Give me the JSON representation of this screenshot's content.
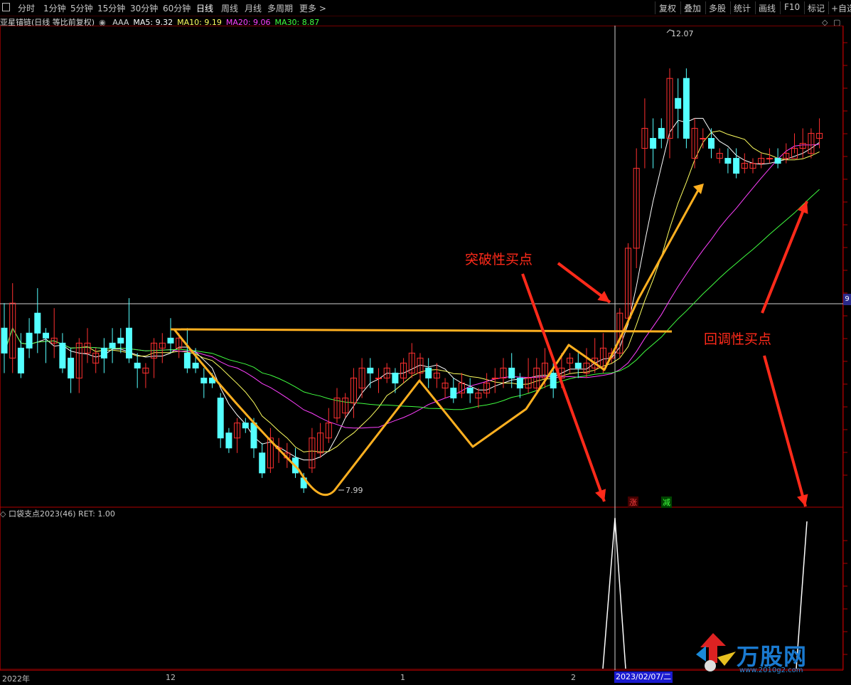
{
  "toolbar": {
    "periods": [
      "分时",
      "1分钟",
      "5分钟",
      "15分钟",
      "30分钟",
      "60分钟",
      "日线",
      "周线",
      "月线",
      "多周期",
      "更多"
    ],
    "active": "日线",
    "right": [
      "复权",
      "叠加",
      "多股",
      "统计",
      "画线",
      "F10",
      "标记",
      "+自选"
    ]
  },
  "legend": {
    "stock": "亚星锚链(日线 等比前复权)",
    "indicator": "AAA",
    "ma5": "MA5: 9.32",
    "ma10": "MA10: 9.19",
    "ma20": "MA20: 9.06",
    "ma30": "MA30: 8.87"
  },
  "price_labels": {
    "high": "12.07",
    "low": "7.99",
    "axis_tag": "9"
  },
  "annotations": {
    "breakout": "突破性买点",
    "pullback": "回调性买点"
  },
  "badges": {
    "up": "涨",
    "down": "减"
  },
  "sub_legend": {
    "name": "口袋支点2023(46)",
    "ret": "RET: 1.00"
  },
  "x_axis": {
    "year": "2022年",
    "m12": "12",
    "m1": "1",
    "m2": "2",
    "cursor_date": "2023/02/07/二"
  },
  "watermark": {
    "text": "万股网",
    "url": "www.2010g2.com"
  },
  "colors": {
    "up": "#ff3030",
    "down": "#54ffff",
    "ma5": "#ffffff",
    "ma10": "#ffff60",
    "ma20": "#ff40ff",
    "ma30": "#40ff40",
    "annotation": "#ff2a1a",
    "pattern": "#ffb020"
  },
  "chart_data": {
    "type": "candlestick",
    "y_range": [
      7.6,
      12.3
    ],
    "candles": [
      [
        9.3,
        9.05,
        9.55,
        8.85
      ],
      [
        9.0,
        9.55,
        9.75,
        8.85
      ],
      [
        9.1,
        8.85,
        9.25,
        8.8
      ],
      [
        9.25,
        9.1,
        9.4,
        9.0
      ],
      [
        9.45,
        9.25,
        9.7,
        9.05
      ],
      [
        9.25,
        9.2,
        9.3,
        8.95
      ],
      [
        9.15,
        9.2,
        9.5,
        9.0
      ],
      [
        9.15,
        8.9,
        9.25,
        8.85
      ],
      [
        9.0,
        8.8,
        9.1,
        8.65
      ],
      [
        8.8,
        9.15,
        9.2,
        8.65
      ],
      [
        9.05,
        9.15,
        9.3,
        8.95
      ],
      [
        8.95,
        9.05,
        9.1,
        8.85
      ],
      [
        9.1,
        9.0,
        9.2,
        8.85
      ],
      [
        9.15,
        9.1,
        9.3,
        8.95
      ],
      [
        9.2,
        9.15,
        9.3,
        9.05
      ],
      [
        9.3,
        9.0,
        9.6,
        8.95
      ],
      [
        8.95,
        8.9,
        9.05,
        8.7
      ],
      [
        8.85,
        8.9,
        8.95,
        8.7
      ],
      [
        9.0,
        9.15,
        9.2,
        8.8
      ],
      [
        9.1,
        9.15,
        9.25,
        8.95
      ],
      [
        9.2,
        9.15,
        9.4,
        9.05
      ],
      [
        9.1,
        9.2,
        9.25,
        9.0
      ],
      [
        9.05,
        8.9,
        9.3,
        8.85
      ],
      [
        8.95,
        8.9,
        9.1,
        8.85
      ],
      [
        8.8,
        8.75,
        8.9,
        8.6
      ],
      [
        8.8,
        8.75,
        8.85,
        8.7
      ],
      [
        8.6,
        8.2,
        8.65,
        8.1
      ],
      [
        8.25,
        8.1,
        8.3,
        8.05
      ],
      [
        8.2,
        8.35,
        8.4,
        8.05
      ],
      [
        8.35,
        8.3,
        8.4,
        8.25
      ],
      [
        8.35,
        8.1,
        8.4,
        8.0
      ],
      [
        8.05,
        7.85,
        8.15,
        7.8
      ],
      [
        7.9,
        8.2,
        8.3,
        7.85
      ],
      [
        8.1,
        8.1,
        8.2,
        7.95
      ],
      [
        8.0,
        8.05,
        8.15,
        7.9
      ],
      [
        8.0,
        7.85,
        8.1,
        7.8
      ],
      [
        7.8,
        7.7,
        7.85,
        7.65
      ],
      [
        7.9,
        8.2,
        8.3,
        7.85
      ],
      [
        8.05,
        8.25,
        8.35,
        8.0
      ],
      [
        8.2,
        8.35,
        8.5,
        8.15
      ],
      [
        8.4,
        8.6,
        8.7,
        8.35
      ],
      [
        8.45,
        8.6,
        8.65,
        8.4
      ],
      [
        8.55,
        8.8,
        8.9,
        8.4
      ],
      [
        8.7,
        8.9,
        9.0,
        8.6
      ],
      [
        8.9,
        8.85,
        9.0,
        8.7
      ],
      [
        8.8,
        8.8,
        8.9,
        8.65
      ],
      [
        8.8,
        8.9,
        8.95,
        8.75
      ],
      [
        8.85,
        8.75,
        8.9,
        8.65
      ],
      [
        8.8,
        8.95,
        9.0,
        8.75
      ],
      [
        8.85,
        9.05,
        9.15,
        8.8
      ],
      [
        8.85,
        9.0,
        9.05,
        8.75
      ],
      [
        8.9,
        8.8,
        9.0,
        8.7
      ],
      [
        8.8,
        8.85,
        8.95,
        8.7
      ],
      [
        8.7,
        8.75,
        8.8,
        8.6
      ],
      [
        8.7,
        8.6,
        8.8,
        8.55
      ],
      [
        8.65,
        8.75,
        8.85,
        8.6
      ],
      [
        8.7,
        8.65,
        8.8,
        8.55
      ],
      [
        8.6,
        8.65,
        8.7,
        8.5
      ],
      [
        8.65,
        8.75,
        8.85,
        8.6
      ],
      [
        8.8,
        8.8,
        8.9,
        8.65
      ],
      [
        8.8,
        8.9,
        9.0,
        8.7
      ],
      [
        8.9,
        8.8,
        9.05,
        8.7
      ],
      [
        8.8,
        8.7,
        8.85,
        8.6
      ],
      [
        8.7,
        8.8,
        9.0,
        8.65
      ],
      [
        8.7,
        8.9,
        9.0,
        8.65
      ],
      [
        8.8,
        8.95,
        9.1,
        8.7
      ],
      [
        8.85,
        8.7,
        8.95,
        8.6
      ],
      [
        8.8,
        8.9,
        9.05,
        8.7
      ],
      [
        8.95,
        9.0,
        9.05,
        8.85
      ],
      [
        8.95,
        8.9,
        9.05,
        8.8
      ],
      [
        8.85,
        8.95,
        9.1,
        8.8
      ],
      [
        8.9,
        9.0,
        9.2,
        8.85
      ],
      [
        8.9,
        9.1,
        9.25,
        8.85
      ],
      [
        9.0,
        9.05,
        9.1,
        8.95
      ],
      [
        9.05,
        9.45,
        9.5,
        9.0
      ],
      [
        9.4,
        10.1,
        10.15,
        9.35
      ],
      [
        10.1,
        10.9,
        11.1,
        9.9
      ],
      [
        11.1,
        11.3,
        11.6,
        10.9
      ],
      [
        11.2,
        11.1,
        11.4,
        10.9
      ],
      [
        11.3,
        11.2,
        11.4,
        11.1
      ],
      [
        11.2,
        11.8,
        11.9,
        11.0
      ],
      [
        11.6,
        11.5,
        11.8,
        11.2
      ],
      [
        11.8,
        11.2,
        11.9,
        11.1
      ],
      [
        11.0,
        11.3,
        11.4,
        10.9
      ],
      [
        11.2,
        11.2,
        11.3,
        11.1
      ],
      [
        11.2,
        11.1,
        11.3,
        11.0
      ],
      [
        11.0,
        11.05,
        11.1,
        10.95
      ],
      [
        11.0,
        10.95,
        11.1,
        10.85
      ],
      [
        11.0,
        10.85,
        11.1,
        10.8
      ],
      [
        10.9,
        10.95,
        11.05,
        10.85
      ],
      [
        10.9,
        10.95,
        11.0,
        10.85
      ],
      [
        10.95,
        11.0,
        11.05,
        10.9
      ],
      [
        11.0,
        11.0,
        11.1,
        10.95
      ],
      [
        11.0,
        10.95,
        11.1,
        10.9
      ],
      [
        11.0,
        11.05,
        11.15,
        10.95
      ],
      [
        11.0,
        11.1,
        11.25,
        11.05
      ],
      [
        11.1,
        11.15,
        11.3,
        11.0
      ],
      [
        11.05,
        11.25,
        11.3,
        11.0
      ],
      [
        11.2,
        11.25,
        11.4,
        11.1
      ]
    ]
  }
}
